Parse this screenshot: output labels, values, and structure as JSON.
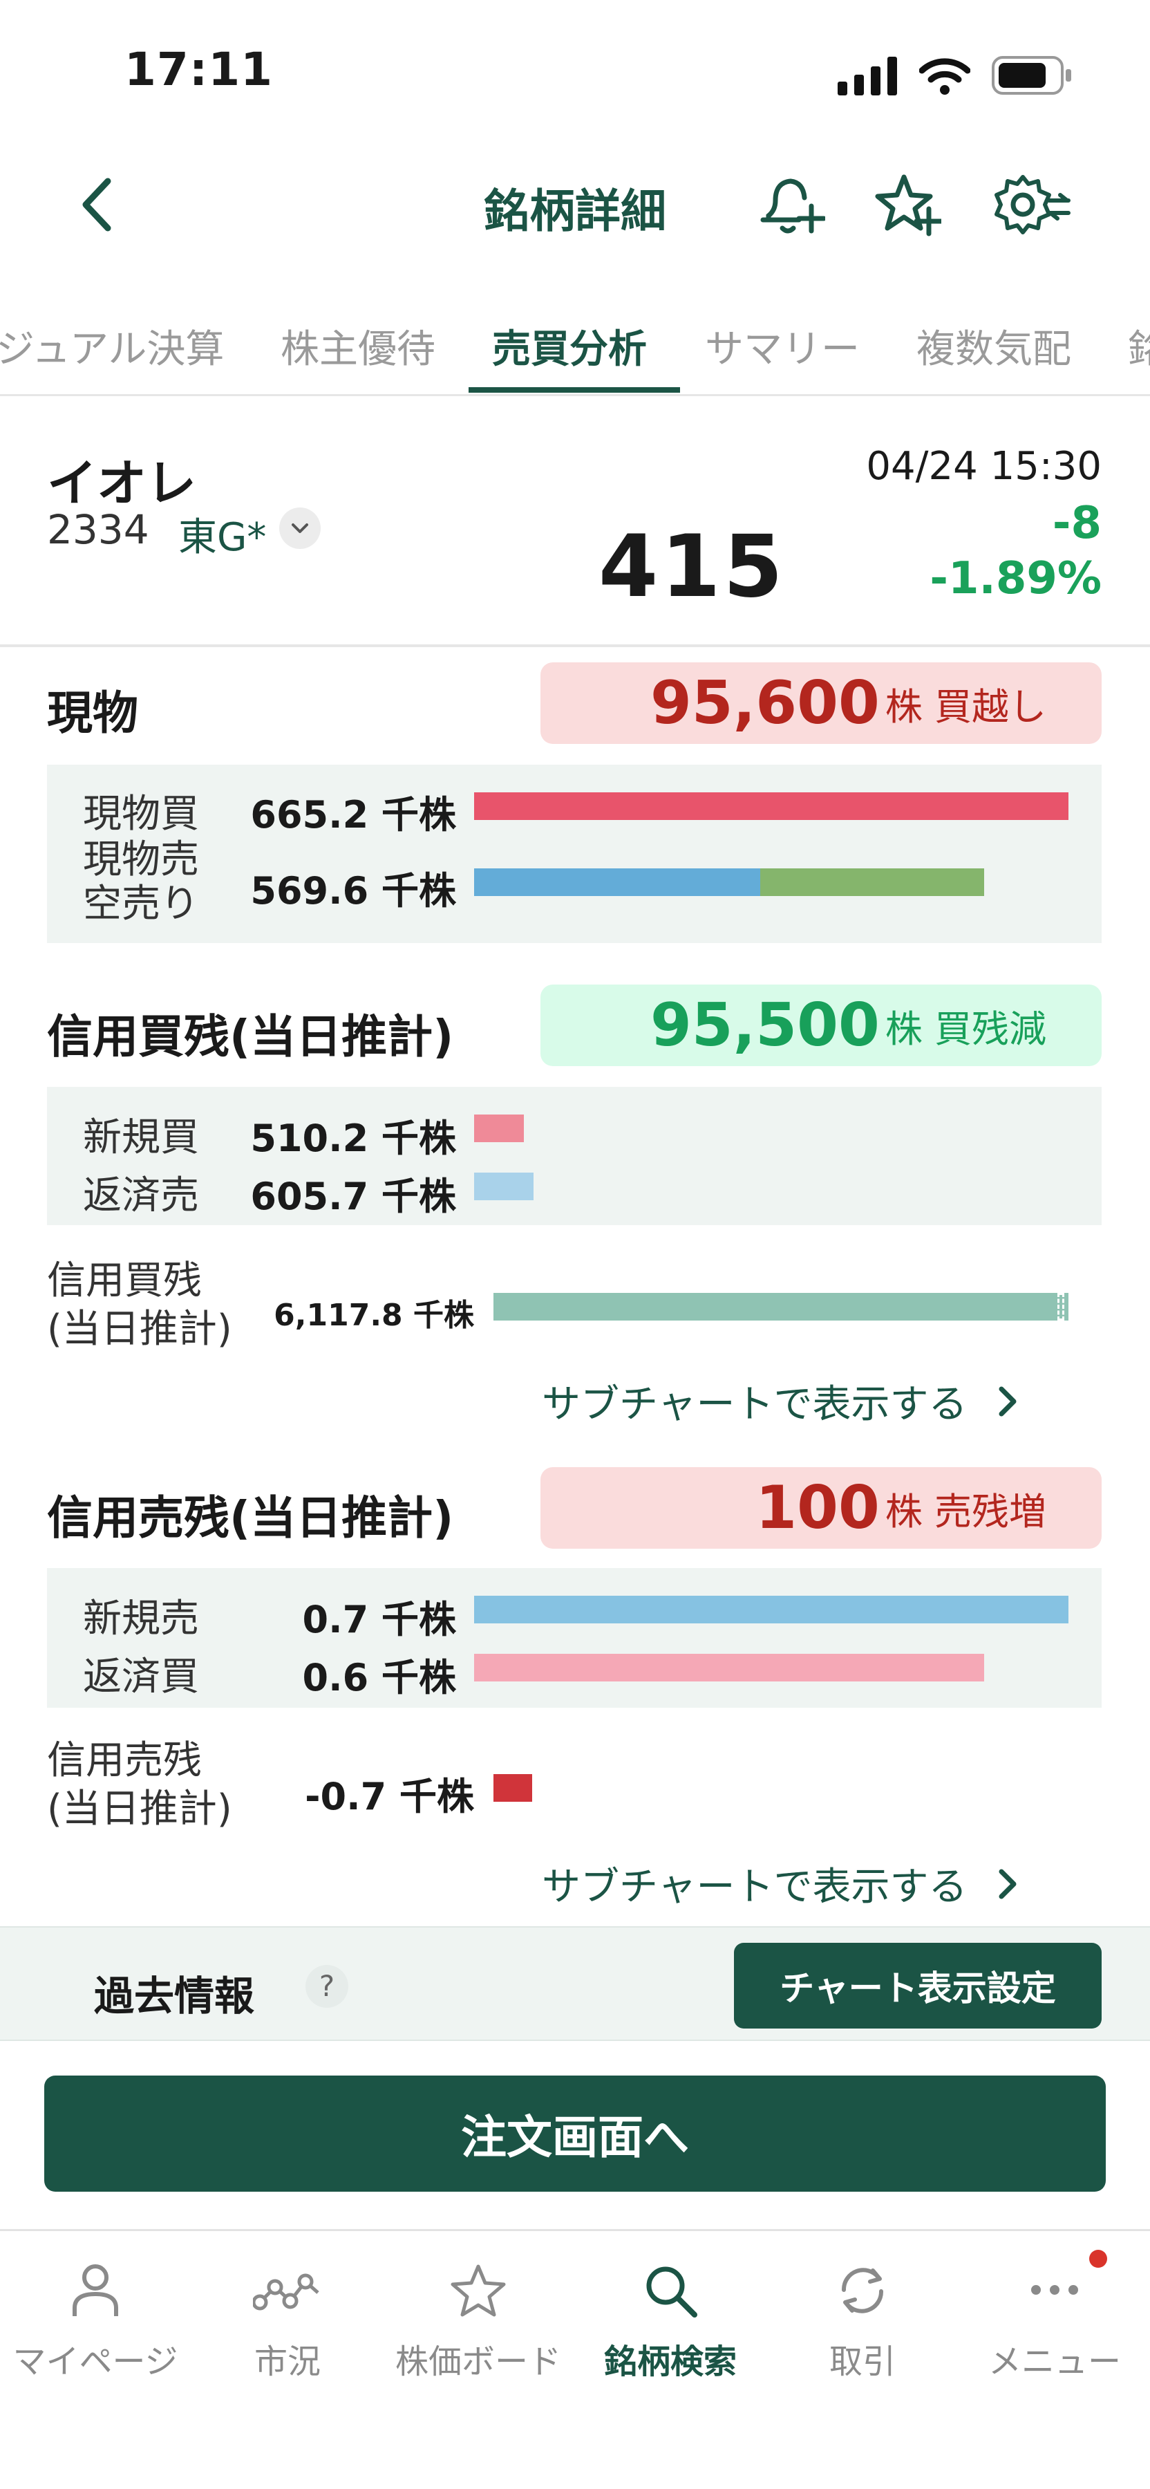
{
  "status_bar": {
    "time": "17:11"
  },
  "header": {
    "title": "銘柄詳細"
  },
  "tabs": [
    {
      "label": "ジュアル決算",
      "active": false
    },
    {
      "label": "株主優待",
      "active": false
    },
    {
      "label": "売買分析",
      "active": true
    },
    {
      "label": "サマリー",
      "active": false
    },
    {
      "label": "複数気配",
      "active": false
    },
    {
      "label": "銘",
      "active": false
    }
  ],
  "stock": {
    "name": "イオレ",
    "code": "2334",
    "market": "東G*",
    "datetime": "04/24 15:30",
    "price": "415",
    "change": "-8",
    "change_pct": "-1.89%"
  },
  "spot": {
    "title": "現物",
    "badge_value": "95,600",
    "badge_unit": "株 買越し",
    "rows": [
      {
        "label": "現物買",
        "value": "665.2",
        "unit": "千株"
      },
      {
        "label_line1": "現物売",
        "label_line2": "空売り",
        "value": "569.6",
        "unit": "千株"
      }
    ],
    "buy_bar_fraction": 1.0,
    "sell_bar_fraction": 0.856,
    "sell_bar_spot_portion": 0.56
  },
  "margin_buy": {
    "title": "信用買残(当日推計)",
    "badge_value": "95,500",
    "badge_unit": "株 買残減",
    "rows": [
      {
        "label": "新規買",
        "value": "510.2",
        "unit": "千株"
      },
      {
        "label": "返済売",
        "value": "605.7",
        "unit": "千株"
      }
    ],
    "balance_label_line1": "信用買残",
    "balance_label_line2": "(当日推計)",
    "balance_value": "6,117.8",
    "balance_unit": "千株",
    "subchart": "サブチャートで表示する"
  },
  "margin_sell": {
    "title": "信用売残(当日推計)",
    "badge_value": "100",
    "badge_unit": "株 売残増",
    "rows": [
      {
        "label": "新規売",
        "value": "0.7",
        "unit": "千株"
      },
      {
        "label": "返済買",
        "value": "0.6",
        "unit": "千株"
      }
    ],
    "balance_label_line1": "信用売残",
    "balance_label_line2": "(当日推計)",
    "balance_value": "-0.7",
    "balance_unit": "千株",
    "subchart": "サブチャートで表示する"
  },
  "past": {
    "label": "過去情報",
    "help": "?",
    "chart_setting": "チャート表示設定"
  },
  "order_button": "注文画面へ",
  "tabbar": [
    {
      "label": "マイページ",
      "icon": "person-icon",
      "active": false
    },
    {
      "label": "市況",
      "icon": "market-graph-icon",
      "active": false
    },
    {
      "label": "株価ボード",
      "icon": "star-icon",
      "active": false
    },
    {
      "label": "銘柄検索",
      "icon": "search-icon",
      "active": true
    },
    {
      "label": "取引",
      "icon": "refresh-icon",
      "active": false
    },
    {
      "label": "メニュー",
      "icon": "more-icon",
      "active": false
    }
  ],
  "colors": {
    "brand": "#1b5445",
    "up_red": "#b3261e",
    "down_green": "#1aa15a",
    "spot_buy_bar": "#e8546b",
    "spot_sell_bar": "#63acd8",
    "short_sell_bar": "#85b56c",
    "margin_new_buy_bar": "#ef8a98",
    "margin_repay_sell_bar": "#a9d2ea",
    "margin_balance_bar": "#8fc3b3",
    "margin_new_sell_bar": "#86c2e2",
    "margin_repay_buy_bar": "#f5a8b6",
    "margin_sell_balance_bar": "#d0343a"
  }
}
